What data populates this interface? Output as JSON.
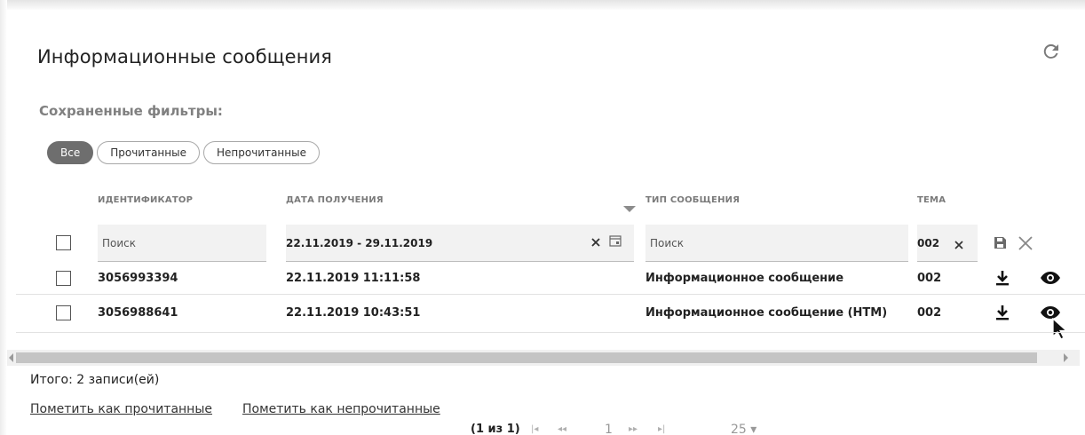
{
  "page": {
    "title": "Информационные сообщения",
    "refresh_icon": "refresh-icon"
  },
  "filters": {
    "label": "Сохраненные фильтры:",
    "chips": [
      "Все",
      "Прочитанные",
      "Непрочитанные"
    ],
    "active_chip": "Все"
  },
  "table": {
    "columns": {
      "id": "ИДЕНТИФИКАТОР",
      "date": "ДАТА ПОЛУЧЕНИЯ",
      "type": "ТИП СООБЩЕНИЯ",
      "subject": "ТЕМА"
    },
    "filter_row": {
      "id_placeholder": "Поиск",
      "date_value": "22.11.2019 - 29.11.2019",
      "type_placeholder": "Поиск",
      "subject_value": "002"
    },
    "rows": [
      {
        "id": "3056993394",
        "date": "22.11.2019 11:11:58",
        "type": "Информационное сообщение",
        "subject": "002"
      },
      {
        "id": "3056988641",
        "date": "22.11.2019 10:43:51",
        "type": "Информационное сообщение (HTM)",
        "subject": "002"
      }
    ]
  },
  "footer": {
    "total": "Итого: 2 записи(ей)",
    "mark_read": "Пометить как прочитанные",
    "mark_unread": "Пометить как непрочитанные",
    "pager_info": "(1 из 1)",
    "current_page": "1",
    "page_size": "25 ▾",
    "first_glyph": "|◂",
    "prev_glyph": "◂◂",
    "next_glyph": "▸▸",
    "last_glyph": "▸|"
  },
  "colors": {
    "active_chip_bg": "#6e6e6e",
    "filter_bg": "#f2f2f2",
    "scroll_thumb": "#c4c4c4"
  }
}
